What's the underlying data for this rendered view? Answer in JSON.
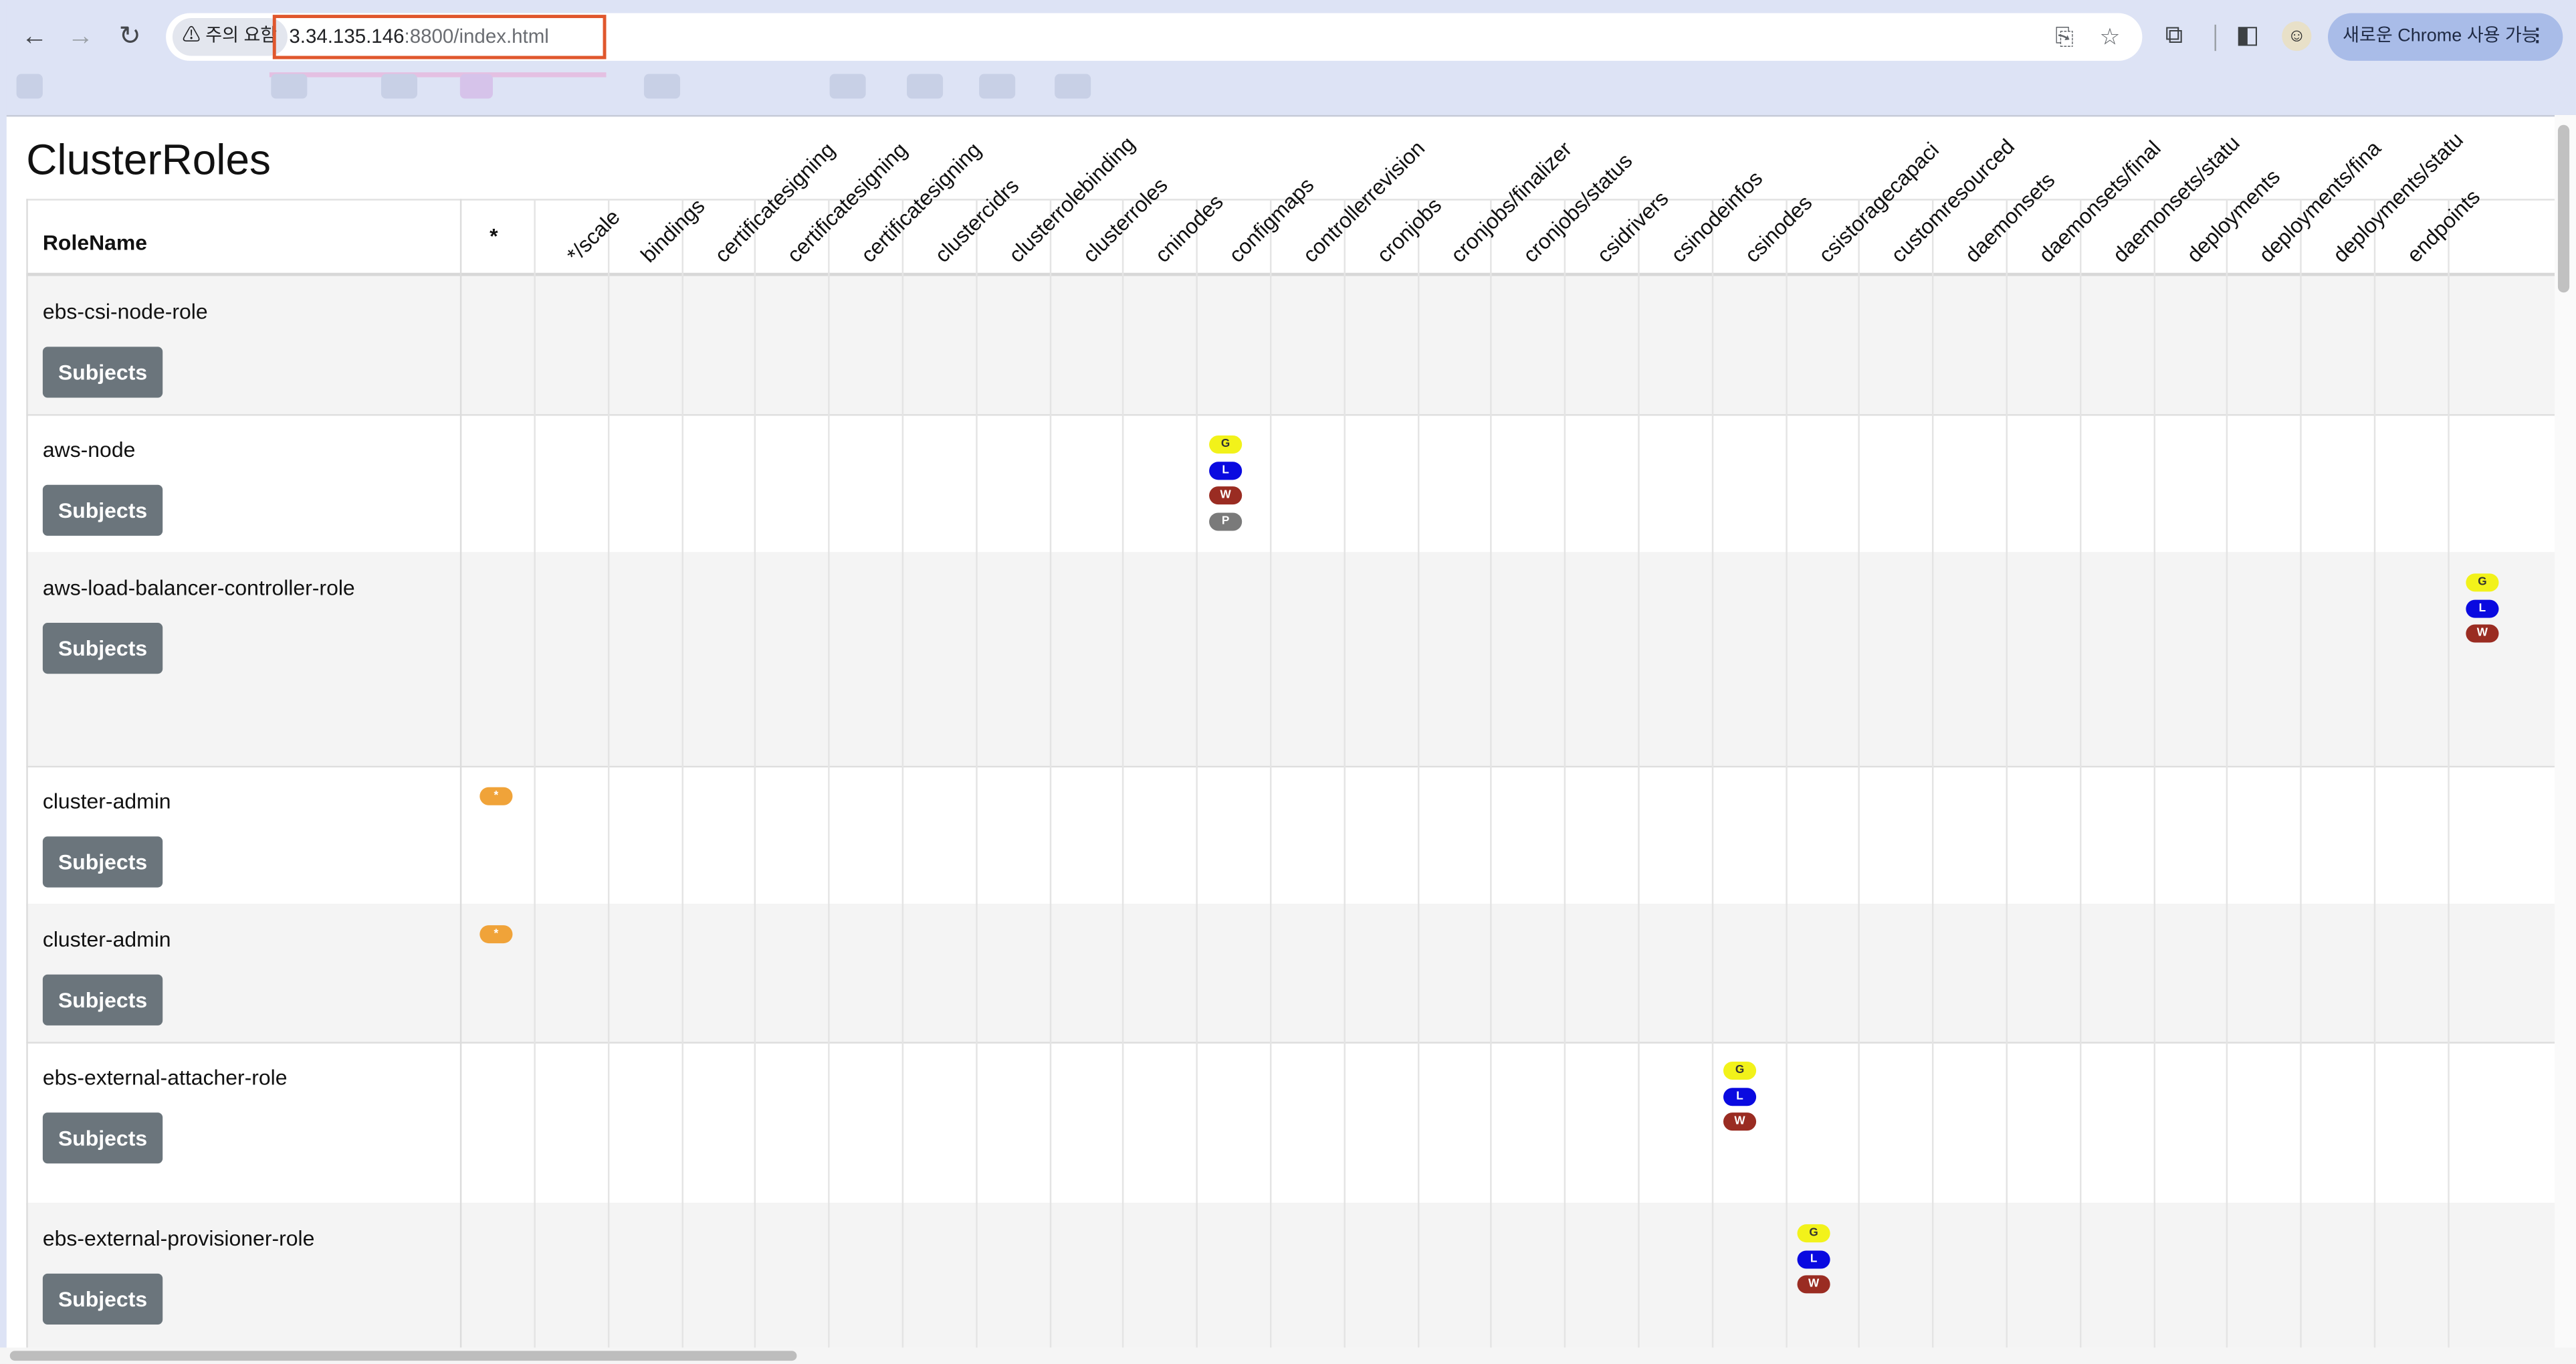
{
  "browser": {
    "security_label": "⚠ 주의 요함",
    "url_host": "3.34.135.146",
    "url_rest": ":8800/index.html",
    "update_label": "새로운 Chrome 사용 가능",
    "icons": [
      "back-icon",
      "forward-icon",
      "reload-icon",
      "translate-icon",
      "bookmark-star-icon",
      "extensions-icon",
      "side-panel-icon",
      "profile-icon",
      "menu-dots-icon"
    ]
  },
  "page": {
    "title": "ClusterRoles",
    "role_header": "RoleName",
    "star_header": "*"
  },
  "columns": [
    "*/scale",
    "bindings",
    "certificatesigning",
    "certificatesigning",
    "certificatesigning",
    "clustercidrs",
    "clusterrolebinding",
    "clusterroles",
    "cninodes",
    "configmaps",
    "controllerrevision",
    "cronjobs",
    "cronjobs/finalizer",
    "cronjobs/status",
    "csidrivers",
    "csinodeinfos",
    "csinodes",
    "csistoragecapaci",
    "customresourced",
    "daemonsets",
    "daemonsets/final",
    "daemonsets/statu",
    "deployments",
    "deployments/fina",
    "deployments/statu",
    "endpoints"
  ],
  "subjects_label": "Subjects",
  "rows": [
    {
      "name": "ebs-csi-node-role"
    },
    {
      "name": "aws-node"
    },
    {
      "name": "aws-load-balancer-controller-role"
    },
    {
      "name": "cluster-admin"
    },
    {
      "name": "cluster-admin"
    },
    {
      "name": "ebs-external-attacher-role"
    },
    {
      "name": "ebs-external-provisioner-role"
    }
  ],
  "badges": {
    "star": "*",
    "aws_node_cninodes": [
      "G",
      "L",
      "W",
      "P"
    ],
    "lb_endpoints": [
      "G",
      "L",
      "W"
    ],
    "attacher_csinodeinfos": [
      "G",
      "L",
      "W"
    ],
    "provisioner_csinodes": [
      "G",
      "L",
      "W"
    ]
  },
  "colors": {
    "get": "#f2f21a",
    "list": "#0a0ae0",
    "watch": "#9a2c22",
    "patch": "#7a7a7a",
    "all": "#f0a339",
    "button": "#6b757c",
    "url_highlight": "#e0572d"
  }
}
